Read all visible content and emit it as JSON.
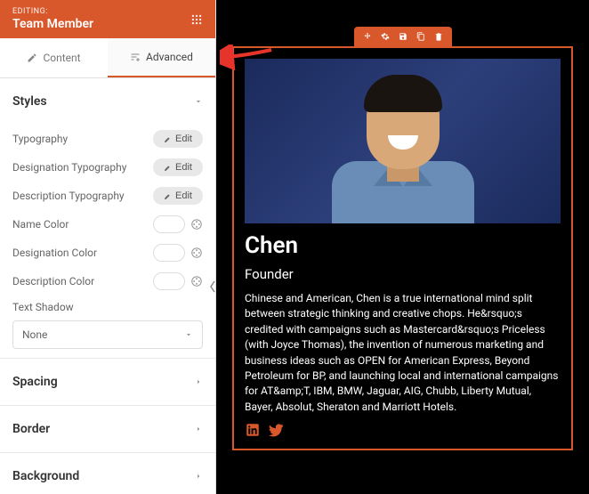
{
  "header": {
    "editing_label": "EDITING:",
    "widget_name": "Team Member"
  },
  "tabs": {
    "content": "Content",
    "advanced": "Advanced"
  },
  "sections": {
    "styles": {
      "title": "Styles",
      "typography": "Typography",
      "designation_typography": "Designation Typography",
      "description_typography": "Description Typography",
      "name_color": "Name Color",
      "designation_color": "Designation Color",
      "description_color": "Description Color",
      "text_shadow": "Text Shadow",
      "text_shadow_value": "None",
      "edit_label": "Edit"
    },
    "spacing": {
      "title": "Spacing"
    },
    "border": {
      "title": "Border"
    },
    "background": {
      "title": "Background"
    }
  },
  "member": {
    "name": "Chen",
    "role": "Founder",
    "bio": "Chinese and American, Chen is a true international mind split between strategic thinking and creative chops. He&rsquo;s credited with campaigns such as Mastercard&rsquo;s Priceless (with Joyce Thomas), the invention of numerous marketing and business ideas such as OPEN for American Express, Beyond Petroleum for BP, and launching local and international campaigns for AT&amp;T, IBM, BMW, Jaguar, AIG, Chubb, Liberty Mutual, Bayer, Absolut, Sheraton and Marriott Hotels."
  }
}
